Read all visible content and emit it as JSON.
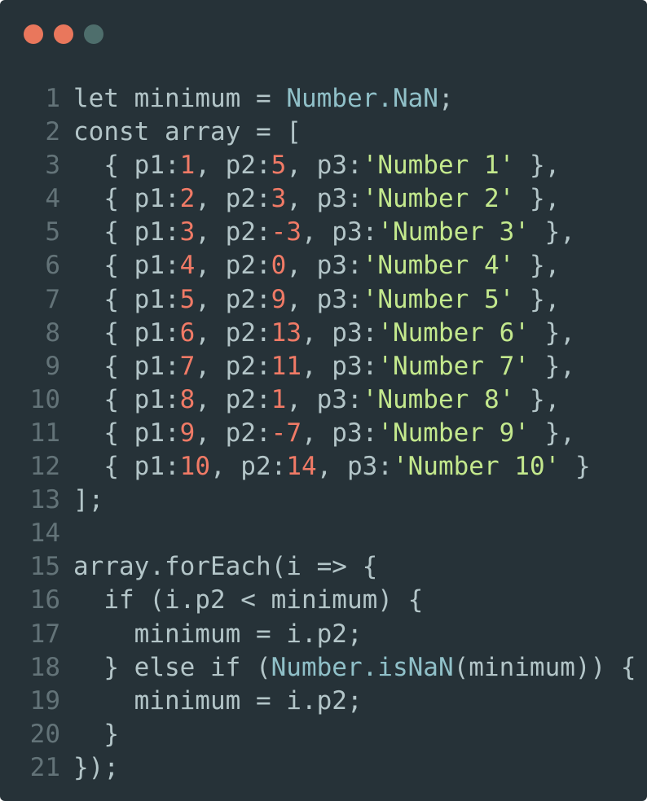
{
  "window": {
    "controls": [
      {
        "name": "close",
        "color": "#e9775c"
      },
      {
        "name": "minimize",
        "color": "#e9775c"
      },
      {
        "name": "maximize",
        "color": "#4e6e6c"
      }
    ]
  },
  "colors": {
    "background": "#263238",
    "number": "#f07a66",
    "string": "#c3e88d",
    "text": "#b3c5c8",
    "line_number": "#637378"
  },
  "code": {
    "language": "javascript",
    "lines": [
      {
        "n": "1",
        "tokens": [
          [
            "kw",
            "let"
          ],
          [
            "plain",
            " minimum = "
          ],
          [
            "type",
            "Number.NaN"
          ],
          [
            "plain",
            ";"
          ]
        ]
      },
      {
        "n": "2",
        "tokens": [
          [
            "kw",
            "const"
          ],
          [
            "plain",
            " array = ["
          ]
        ]
      },
      {
        "n": "3",
        "tokens": [
          [
            "plain",
            "  { p1:"
          ],
          [
            "num",
            "1"
          ],
          [
            "plain",
            ", p2:"
          ],
          [
            "num",
            "5"
          ],
          [
            "plain",
            ", p3:"
          ],
          [
            "str",
            "'Number 1'"
          ],
          [
            "plain",
            " },"
          ]
        ]
      },
      {
        "n": "4",
        "tokens": [
          [
            "plain",
            "  { p1:"
          ],
          [
            "num",
            "2"
          ],
          [
            "plain",
            ", p2:"
          ],
          [
            "num",
            "3"
          ],
          [
            "plain",
            ", p3:"
          ],
          [
            "str",
            "'Number 2'"
          ],
          [
            "plain",
            " },"
          ]
        ]
      },
      {
        "n": "5",
        "tokens": [
          [
            "plain",
            "  { p1:"
          ],
          [
            "num",
            "3"
          ],
          [
            "plain",
            ", p2:"
          ],
          [
            "num",
            "-3"
          ],
          [
            "plain",
            ", p3:"
          ],
          [
            "str",
            "'Number 3'"
          ],
          [
            "plain",
            " },"
          ]
        ]
      },
      {
        "n": "6",
        "tokens": [
          [
            "plain",
            "  { p1:"
          ],
          [
            "num",
            "4"
          ],
          [
            "plain",
            ", p2:"
          ],
          [
            "num",
            "0"
          ],
          [
            "plain",
            ", p3:"
          ],
          [
            "str",
            "'Number 4'"
          ],
          [
            "plain",
            " },"
          ]
        ]
      },
      {
        "n": "7",
        "tokens": [
          [
            "plain",
            "  { p1:"
          ],
          [
            "num",
            "5"
          ],
          [
            "plain",
            ", p2:"
          ],
          [
            "num",
            "9"
          ],
          [
            "plain",
            ", p3:"
          ],
          [
            "str",
            "'Number 5'"
          ],
          [
            "plain",
            " },"
          ]
        ]
      },
      {
        "n": "8",
        "tokens": [
          [
            "plain",
            "  { p1:"
          ],
          [
            "num",
            "6"
          ],
          [
            "plain",
            ", p2:"
          ],
          [
            "num",
            "13"
          ],
          [
            "plain",
            ", p3:"
          ],
          [
            "str",
            "'Number 6'"
          ],
          [
            "plain",
            " },"
          ]
        ]
      },
      {
        "n": "9",
        "tokens": [
          [
            "plain",
            "  { p1:"
          ],
          [
            "num",
            "7"
          ],
          [
            "plain",
            ", p2:"
          ],
          [
            "num",
            "11"
          ],
          [
            "plain",
            ", p3:"
          ],
          [
            "str",
            "'Number 7'"
          ],
          [
            "plain",
            " },"
          ]
        ]
      },
      {
        "n": "10",
        "tokens": [
          [
            "plain",
            "  { p1:"
          ],
          [
            "num",
            "8"
          ],
          [
            "plain",
            ", p2:"
          ],
          [
            "num",
            "1"
          ],
          [
            "plain",
            ", p3:"
          ],
          [
            "str",
            "'Number 8'"
          ],
          [
            "plain",
            " },"
          ]
        ]
      },
      {
        "n": "11",
        "tokens": [
          [
            "plain",
            "  { p1:"
          ],
          [
            "num",
            "9"
          ],
          [
            "plain",
            ", p2:"
          ],
          [
            "num",
            "-7"
          ],
          [
            "plain",
            ", p3:"
          ],
          [
            "str",
            "'Number 9'"
          ],
          [
            "plain",
            " },"
          ]
        ]
      },
      {
        "n": "12",
        "tokens": [
          [
            "plain",
            "  { p1:"
          ],
          [
            "num",
            "10"
          ],
          [
            "plain",
            ", p2:"
          ],
          [
            "num",
            "14"
          ],
          [
            "plain",
            ", p3:"
          ],
          [
            "str",
            "'Number 10'"
          ],
          [
            "plain",
            " }"
          ]
        ]
      },
      {
        "n": "13",
        "tokens": [
          [
            "plain",
            "];"
          ]
        ]
      },
      {
        "n": "14",
        "tokens": []
      },
      {
        "n": "15",
        "tokens": [
          [
            "plain",
            "array.forEach(i => {"
          ]
        ]
      },
      {
        "n": "16",
        "tokens": [
          [
            "plain",
            "  "
          ],
          [
            "kw",
            "if"
          ],
          [
            "plain",
            " (i.p2 < minimum) {"
          ]
        ]
      },
      {
        "n": "17",
        "tokens": [
          [
            "plain",
            "    minimum = i.p2;"
          ]
        ]
      },
      {
        "n": "18",
        "tokens": [
          [
            "plain",
            "  } "
          ],
          [
            "kw",
            "else if"
          ],
          [
            "plain",
            " ("
          ],
          [
            "type",
            "Number.isNaN"
          ],
          [
            "plain",
            "(minimum)) {"
          ]
        ]
      },
      {
        "n": "19",
        "tokens": [
          [
            "plain",
            "    minimum = i.p2;"
          ]
        ]
      },
      {
        "n": "20",
        "tokens": [
          [
            "plain",
            "  }"
          ]
        ]
      },
      {
        "n": "21",
        "tokens": [
          [
            "plain",
            "});"
          ]
        ]
      }
    ]
  }
}
